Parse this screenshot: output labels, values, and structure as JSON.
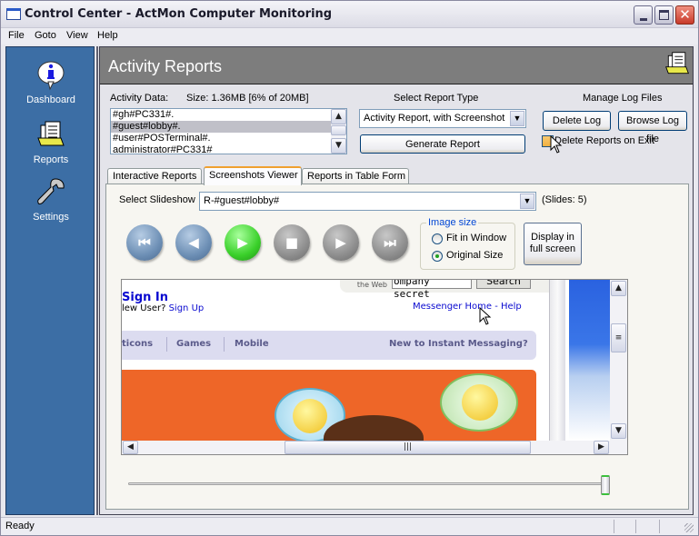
{
  "window": {
    "title": "Control Center - ActMon Computer Monitoring",
    "controls": {
      "minimize": "minimize",
      "maximize": "maximize",
      "close": "close"
    }
  },
  "menu": [
    "File",
    "Goto",
    "View",
    "Help"
  ],
  "sidebar": {
    "items": [
      {
        "label": "Dashboard",
        "icon": "info-bubble-icon"
      },
      {
        "label": "Reports",
        "icon": "reports-folder-icon"
      },
      {
        "label": "Settings",
        "icon": "wrench-icon"
      }
    ]
  },
  "header": {
    "title": "Activity Reports",
    "icon": "reports-folder-icon"
  },
  "activity_data": {
    "label": "Activity Data:",
    "size_text": "Size: 1.36MB [6% of 20MB]",
    "items": [
      "#gh#PC331#.",
      "#guest#lobby#.",
      "#user#POSTerminal#.",
      "administrator#PC331#"
    ],
    "selected_index": 1
  },
  "report_type": {
    "label": "Select Report Type",
    "selected": "Activity Report, with Screenshot",
    "generate_label": "Generate Report"
  },
  "log_files": {
    "label": "Manage Log Files",
    "delete_label": "Delete Log",
    "browse_label": "Browse Log file",
    "delete_on_exit_label": "Delete Reports on Exit",
    "delete_on_exit_checked": false
  },
  "tabs": [
    {
      "label": "Interactive Reports",
      "active": false
    },
    {
      "label": "Screenshots Viewer",
      "active": true
    },
    {
      "label": "Reports in Table Form",
      "active": false
    }
  ],
  "viewer": {
    "slideshow_label": "Select Slideshow",
    "slideshow_selected": "R-#guest#lobby#",
    "slides_count": "(Slides: 5)",
    "controls": [
      "first",
      "previous",
      "play",
      "stop",
      "next",
      "last"
    ],
    "image_size": {
      "legend": "Image size",
      "options": [
        "Fit in Window",
        "Original Size"
      ],
      "selected": "Original Size"
    },
    "fullscreen_label": "Display in full screen",
    "position_percent": 100
  },
  "screenshot": {
    "sign_in": "Sign In",
    "new_user": "lew User?",
    "sign_up": "Sign Up",
    "search_label_1": "Search",
    "search_label_2": "the Web",
    "search_value": "ompany secret",
    "search_button": "Search",
    "messenger_home": "Messenger Home",
    "dash": " - ",
    "help": "Help",
    "nav": [
      "ticons",
      "Games",
      "Mobile"
    ],
    "new_to_im": "New to Instant Messaging?"
  },
  "status": {
    "text": "Ready"
  }
}
